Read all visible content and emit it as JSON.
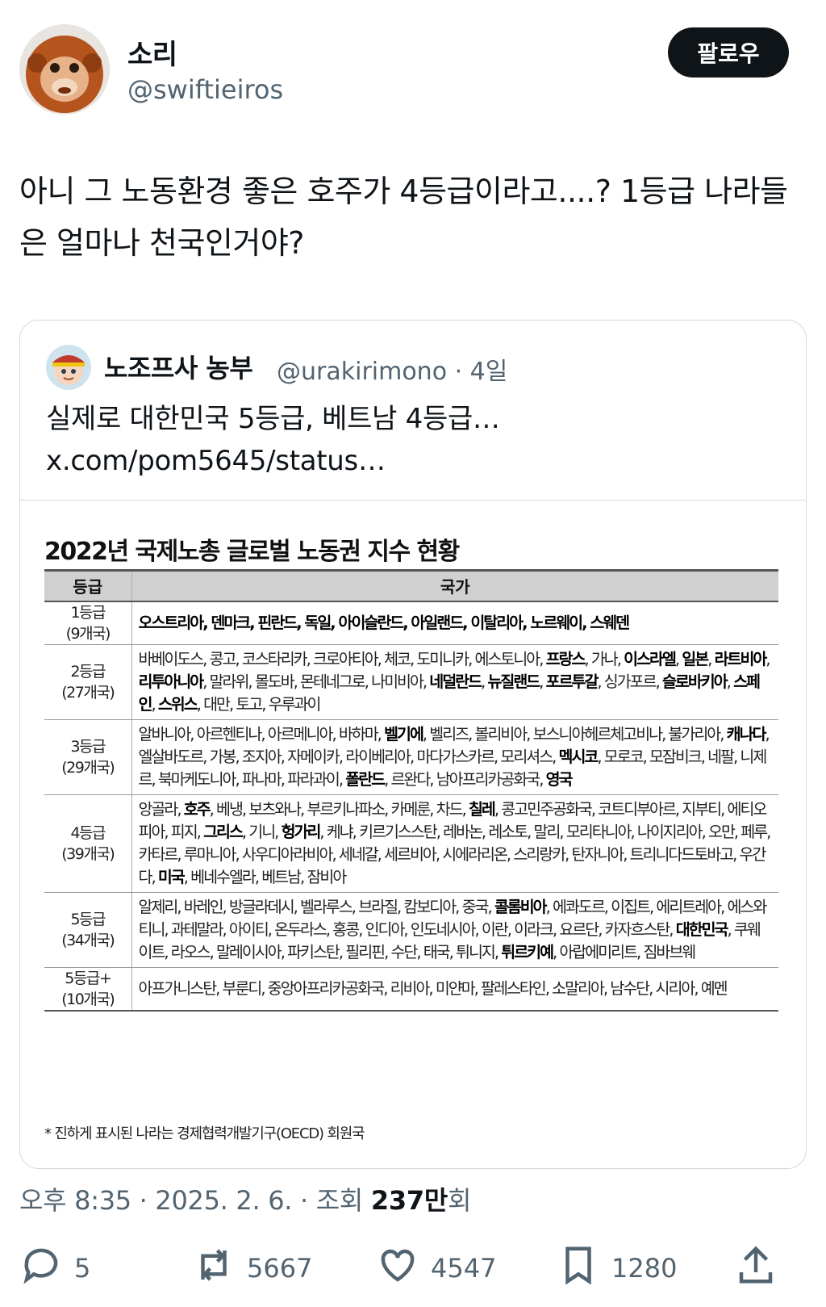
{
  "tweet": {
    "display_name": "소리",
    "handle": "@swiftieiros",
    "follow_label": "팔로우",
    "text": "아니 그 노동환경 좋은 호주가 4등급이라고....?  1등급 나라들은 얼마나 천국인거야?",
    "timestamp": "오후 8:35 · 2025. 2. 6. · 조회 ",
    "views_number": "237만",
    "views_suffix": "회"
  },
  "quote": {
    "display_name": "노조프사 농부",
    "handle": "@urakirimono · 4일",
    "text": "실제로 대한민국 5등급, 베트남 4등급… x.com/pom5645/status…",
    "image": {
      "title": "2022년 국제노총 글로벌 노동권 지수 현황",
      "col_grade": "등급",
      "col_country": "국가",
      "rows": [
        {
          "grade": "1등급",
          "count": "(9개국)",
          "html": "<b>오스트리아, 덴마크, 핀란드, 독일, 아이슬란드, 아일랜드, 이탈리아, 노르웨이, 스웨덴</b>"
        },
        {
          "grade": "2등급",
          "count": "(27개국)",
          "html": "바베이도스, 콩고, 코스타리카, 크로아티아, 체코, 도미니카, 에스토니아, <b>프랑스</b>, 가나, <b>이스라엘</b>, <b>일본</b>, <b>라트비아</b>, <b>리투아니아</b>, 말라위, 몰도바, 몬테네그로, 나미비아, <b>네덜란드</b>, <b>뉴질랜드</b>, <b>포르투갈</b>, 싱가포르, <b>슬로바키아</b>, <b>스페인</b>, <b>스위스</b>, 대만, 토고, 우루과이"
        },
        {
          "grade": "3등급",
          "count": "(29개국)",
          "html": "알바니아, 아르헨티나, 아르메니아, 바하마, <b>벨기에</b>, 벨리즈, 볼리비아, 보스니아헤르체고비나, 불가리아, <b>캐나다</b>, 엘살바도르, 가봉, 조지아, 자메이카, 라이베리아, 마다가스카르, 모리셔스, <b>멕시코</b>, 모로코, 모잠비크, 네팔, 니제르, 북마케도니아, 파나마, 파라과이, <b>폴란드</b>, 르완다, 남아프리카공화국, <b>영국</b>"
        },
        {
          "grade": "4등급",
          "count": "(39개국)",
          "html": "앙골라, <b>호주</b>, 베냉, 보츠와나, 부르키나파소, 카메룬, 차드, <b>칠레</b>, 콩고민주공화국, 코트디부아르, 지부티, 에티오피아, 피지, <b>그리스</b>, 기니, <b>헝가리</b>, 케냐, 키르기스스탄, 레바논, 레소토, 말리, 모리타니아, 나이지리아, 오만, 페루, 카타르, 루마니아, 사우디아라비아, 세네갈, 세르비아, 시에라리온, 스리랑카, 탄자니아, 트리니다드토바고, 우간다, <b>미국</b>, 베네수엘라, 베트남, 잠비아"
        },
        {
          "grade": "5등급",
          "count": "(34개국)",
          "html": "알제리, 바레인, 방글라데시, 벨라루스, 브라질, 캄보디아, 중국, <b>콜롬비아</b>, 에콰도르, 이집트, 에리트레아, 에스와티니, 과테말라, 아이티, 온두라스, 홍콩, 인디아, 인도네시아, 이란, 이라크, 요르단, 카자흐스탄, <b>대한민국</b>, 쿠웨이트, 라오스, 말레이시아, 파키스탄, 필리핀, 수단, 태국, 튀니지, <b>튀르키예</b>, 아랍에미리트, 짐바브웨"
        },
        {
          "grade": "5등급+",
          "count": "(10개국)",
          "html": "아프가니스탄, 부룬디, 중앙아프리카공화국, 리비아, 미얀마, 팔레스타인, 소말리아, 남수단, 시리아, 예멘"
        }
      ],
      "footnote": "* 진하게 표시된 나라는 경제협력개발기구(OECD) 회원국"
    }
  },
  "actions": {
    "reply_icon": "reply-icon",
    "reply_count": "5",
    "retweet_icon": "retweet-icon",
    "retweet_count": "5667",
    "like_icon": "heart-icon",
    "like_count": "4547",
    "bookmark_icon": "bookmark-icon",
    "bookmark_count": "1280",
    "share_icon": "share-icon"
  },
  "colors": {
    "text_primary": "#0f1419",
    "text_secondary": "#536471",
    "border": "#cfd9de",
    "follow_bg": "#0f1419"
  }
}
